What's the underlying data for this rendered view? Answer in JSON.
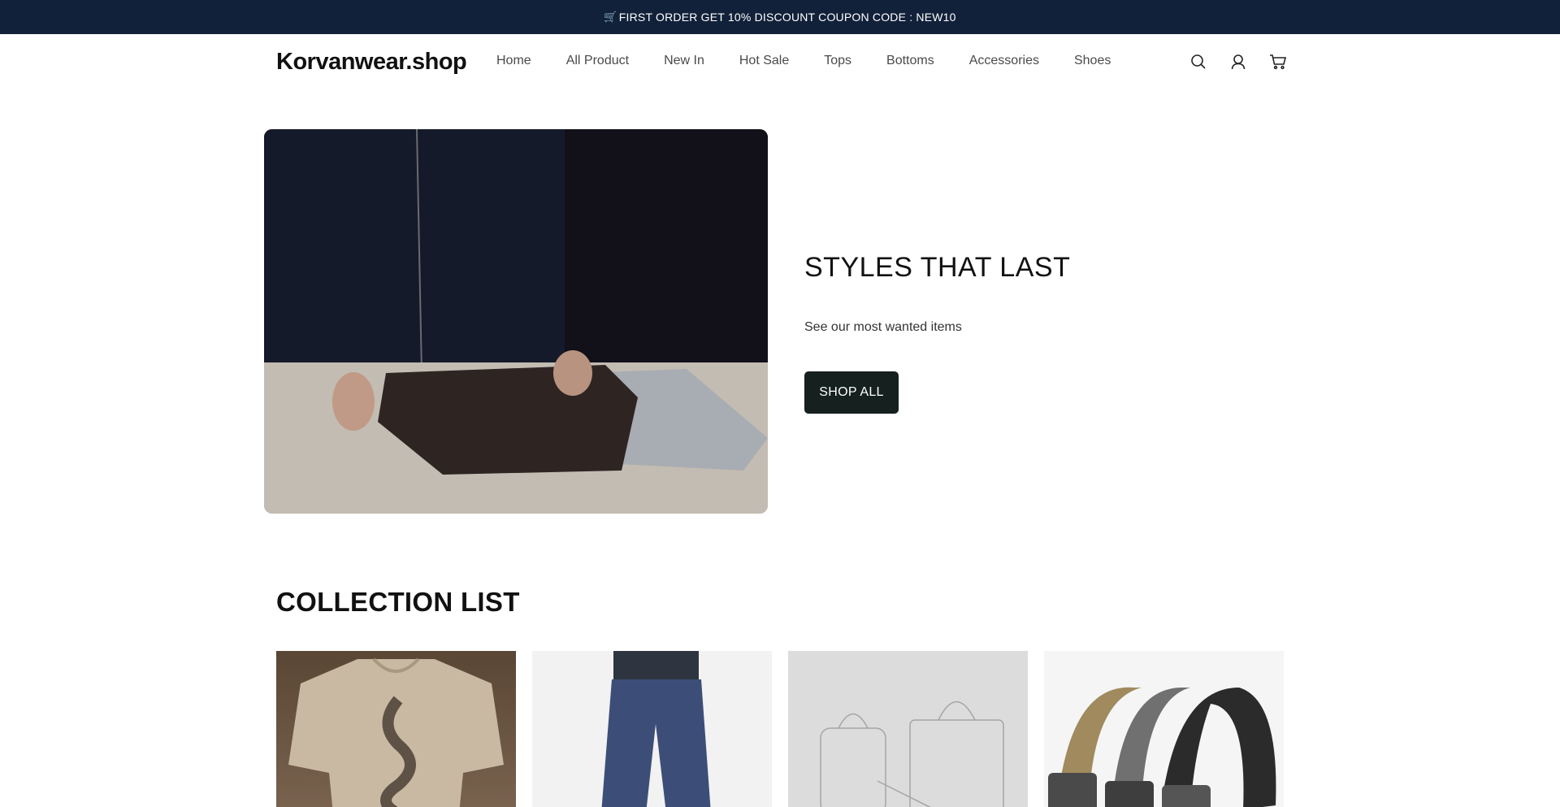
{
  "announcement": {
    "icon": "cart-emoji-icon",
    "text": "FIRST ORDER GET 10% DISCOUNT COUPON CODE : NEW10"
  },
  "header": {
    "logo": "Korvanwear.shop",
    "nav": [
      "Home",
      "All Product",
      "New In",
      "Hot Sale",
      "Tops",
      "Bottoms",
      "Accessories",
      "Shoes"
    ],
    "icons": [
      "search-icon",
      "account-icon",
      "cart-icon"
    ]
  },
  "hero": {
    "title": "STYLES THAT LAST",
    "subtitle": "See our most wanted items",
    "button_label": "SHOP ALL"
  },
  "collection": {
    "title": "COLLECTION LIST"
  },
  "colors": {
    "announcement_bg": "#12213a",
    "button_bg": "#15201f"
  }
}
